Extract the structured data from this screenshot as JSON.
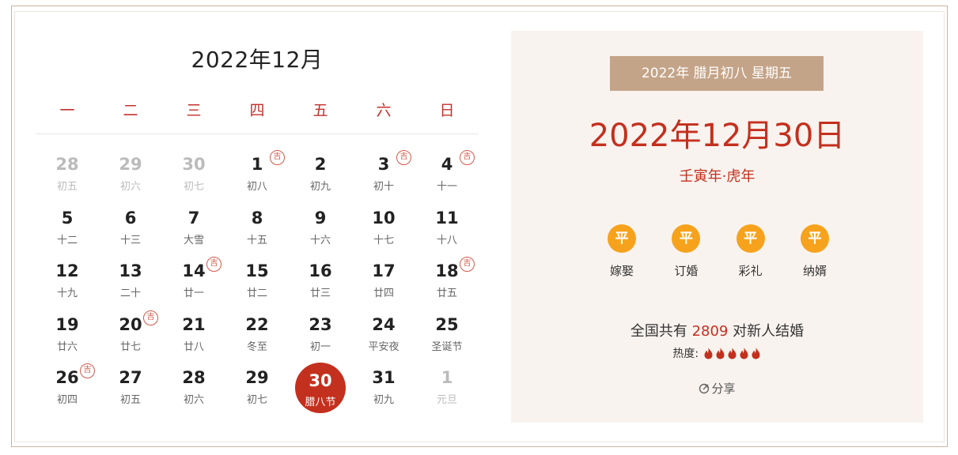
{
  "calendar": {
    "title": "2022年12月",
    "weekdays": [
      "一",
      "二",
      "三",
      "四",
      "五",
      "六",
      "日"
    ],
    "days": [
      {
        "day": "28",
        "lunar": "初五",
        "other": true
      },
      {
        "day": "29",
        "lunar": "初六",
        "other": true
      },
      {
        "day": "30",
        "lunar": "初七",
        "other": true
      },
      {
        "day": "1",
        "lunar": "初八",
        "ji": true
      },
      {
        "day": "2",
        "lunar": "初九"
      },
      {
        "day": "3",
        "lunar": "初十",
        "ji": true
      },
      {
        "day": "4",
        "lunar": "十一",
        "ji": true
      },
      {
        "day": "5",
        "lunar": "十二"
      },
      {
        "day": "6",
        "lunar": "十三"
      },
      {
        "day": "7",
        "lunar": "大雪"
      },
      {
        "day": "8",
        "lunar": "十五"
      },
      {
        "day": "9",
        "lunar": "十六"
      },
      {
        "day": "10",
        "lunar": "十七"
      },
      {
        "day": "11",
        "lunar": "十八"
      },
      {
        "day": "12",
        "lunar": "十九"
      },
      {
        "day": "13",
        "lunar": "二十"
      },
      {
        "day": "14",
        "lunar": "廿一",
        "ji": true
      },
      {
        "day": "15",
        "lunar": "廿二"
      },
      {
        "day": "16",
        "lunar": "廿三"
      },
      {
        "day": "17",
        "lunar": "廿四"
      },
      {
        "day": "18",
        "lunar": "廿五",
        "ji": true
      },
      {
        "day": "19",
        "lunar": "廿六"
      },
      {
        "day": "20",
        "lunar": "廿七",
        "ji": true
      },
      {
        "day": "21",
        "lunar": "廿八"
      },
      {
        "day": "22",
        "lunar": "冬至"
      },
      {
        "day": "23",
        "lunar": "初一"
      },
      {
        "day": "24",
        "lunar": "平安夜"
      },
      {
        "day": "25",
        "lunar": "圣诞节"
      },
      {
        "day": "26",
        "lunar": "初四",
        "ji": true
      },
      {
        "day": "27",
        "lunar": "初五"
      },
      {
        "day": "28",
        "lunar": "初六"
      },
      {
        "day": "29",
        "lunar": "初七"
      },
      {
        "day": "30",
        "lunar": "腊八节",
        "selected": true
      },
      {
        "day": "31",
        "lunar": "初九"
      },
      {
        "day": "1",
        "lunar": "元旦",
        "other": true
      }
    ],
    "ji_badge": "吉"
  },
  "panel": {
    "lunar_banner": "2022年 腊月初八 星期五",
    "big_date": "2022年12月30日",
    "ganzhi": "壬寅年·虎年",
    "activities": [
      {
        "badge": "平",
        "label": "嫁娶"
      },
      {
        "badge": "平",
        "label": "订婚"
      },
      {
        "badge": "平",
        "label": "彩礼"
      },
      {
        "badge": "平",
        "label": "纳婿"
      }
    ],
    "stats_prefix": "全国共有",
    "stats_count": "2809",
    "stats_suffix": "对新人结婚",
    "heat_label": "热度:",
    "heat_level": 5,
    "share_label": "分享"
  },
  "colors": {
    "accent_red": "#c4301e",
    "banner_tan": "#c4a488",
    "badge_orange": "#f7a21d",
    "panel_bg": "#f8f3ef"
  },
  "icons": {
    "heat": "flame-icon",
    "share": "share-icon",
    "ji": "ji-badge-icon"
  }
}
